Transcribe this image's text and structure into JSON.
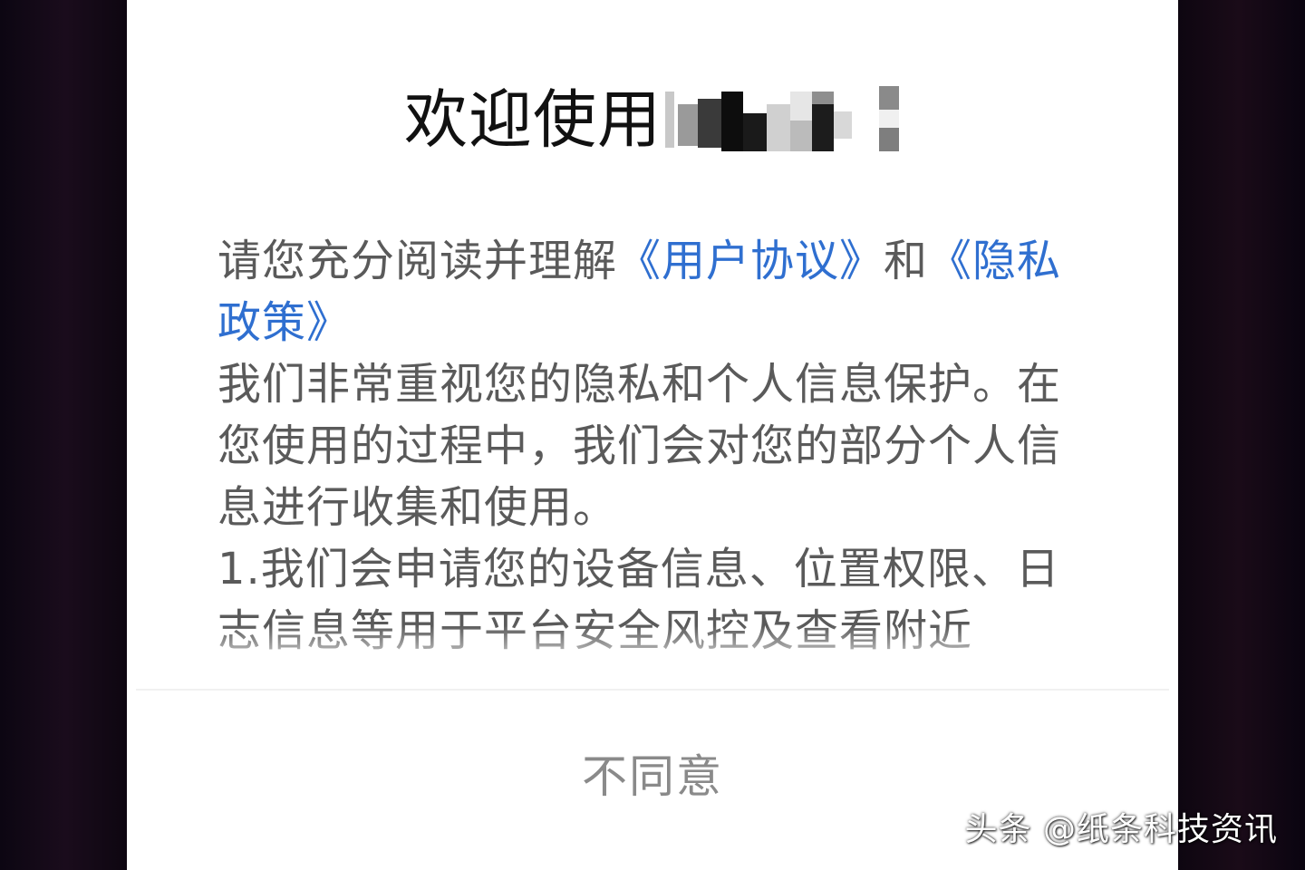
{
  "dialog": {
    "title": "欢迎使用",
    "intro_prefix": "请您充分阅读并理解",
    "user_agreement_link": "《用户协议》",
    "conjunction": "和",
    "privacy_policy_link": "《隐私政策》",
    "paragraph_1": "我们非常重视您的隐私和个人信息保护。在您使用的过程中，我们会对您的部分个人信息进行收集和使用。",
    "paragraph_2": " 1.我们会申请您的设备信息、位置权限、日志信息等用于平台安全风控及查看附近",
    "disagree_button": "不同意"
  },
  "watermark": {
    "text": "头条 @纸条科技资讯"
  },
  "colors": {
    "link": "#2f6fd0",
    "body_text": "#5a5a5a",
    "title_text": "#111111",
    "button_text": "#8a8a8a"
  }
}
